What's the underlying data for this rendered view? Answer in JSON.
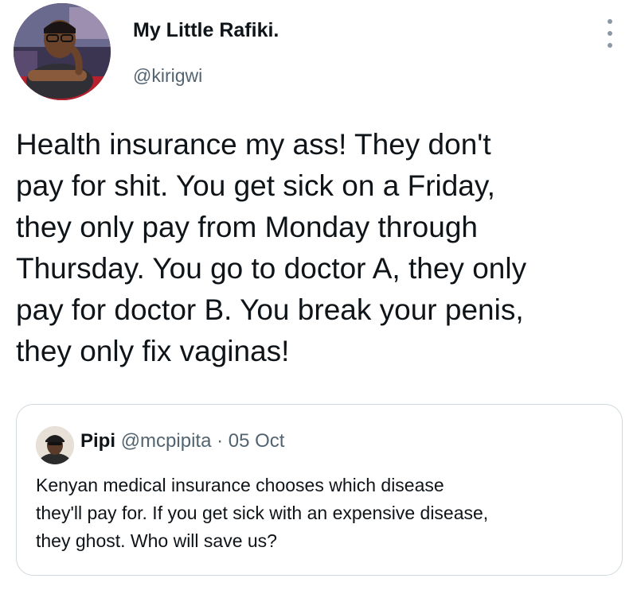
{
  "author": {
    "display_name": "My Little Rafiki.",
    "handle": "@kirigwi"
  },
  "tweet": {
    "lines": [
      "Health insurance my ass! They don't",
      "pay for shit. You get sick on a Friday,",
      "they only pay from Monday through",
      "Thursday. You go to doctor A, they only",
      "pay for doctor B. You break your penis,",
      "they only fix vaginas!"
    ]
  },
  "quote": {
    "display_name": "Pipi",
    "handle": "@mcpipita",
    "separator": "·",
    "date": "05 Oct",
    "lines": [
      "Kenyan medical insurance chooses which disease",
      "they'll pay for. If you get sick with an expensive disease,",
      "they ghost. Who will save us?"
    ]
  },
  "icons": {
    "more": "more-vertical-icon"
  },
  "colors": {
    "text": "#0f1419",
    "secondary": "#536471",
    "border": "#cfd9de"
  }
}
